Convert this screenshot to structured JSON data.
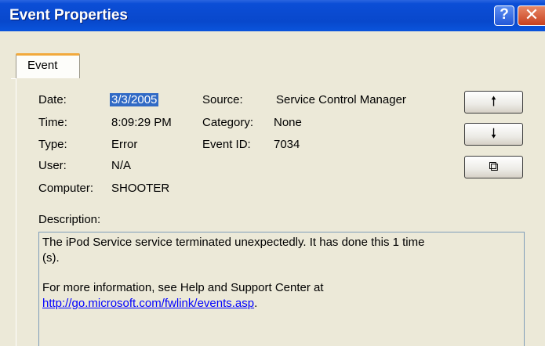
{
  "window": {
    "title": "Event Properties",
    "help_glyph": "?",
    "close_glyph": "✕"
  },
  "tabs": [
    {
      "label": "Event",
      "selected": true
    }
  ],
  "event": {
    "date_label": "Date:",
    "date_value": "3/3/2005",
    "time_label": "Time:",
    "time_value": "8:09:29 PM",
    "type_label": "Type:",
    "type_value": "Error",
    "user_label": "User:",
    "user_value": "N/A",
    "computer_label": "Computer:",
    "computer_value": "SHOOTER",
    "source_label": "Source:",
    "source_value": "Service Control Manager",
    "category_label": "Category:",
    "category_value": "None",
    "event_id_label": "Event ID:",
    "event_id_value": "7034"
  },
  "buttons": {
    "up_glyph": "🠕",
    "down_glyph": "🠗",
    "copy_glyph": "⧉"
  },
  "description": {
    "label": "Description:",
    "line1": "The iPod Service service terminated unexpectedly.  It has done this 1 time",
    "line2": "(s).",
    "line3": "For more information, see Help and Support Center at",
    "link": "http://go.microsoft.com/fwlink/events.asp",
    "link_suffix": "."
  },
  "colors": {
    "titlebar": "#0a4ad0",
    "selection": "#316ac5",
    "tab_highlight": "#f2a93c",
    "link": "#0000ff",
    "dialog_bg": "#ece9d8"
  }
}
